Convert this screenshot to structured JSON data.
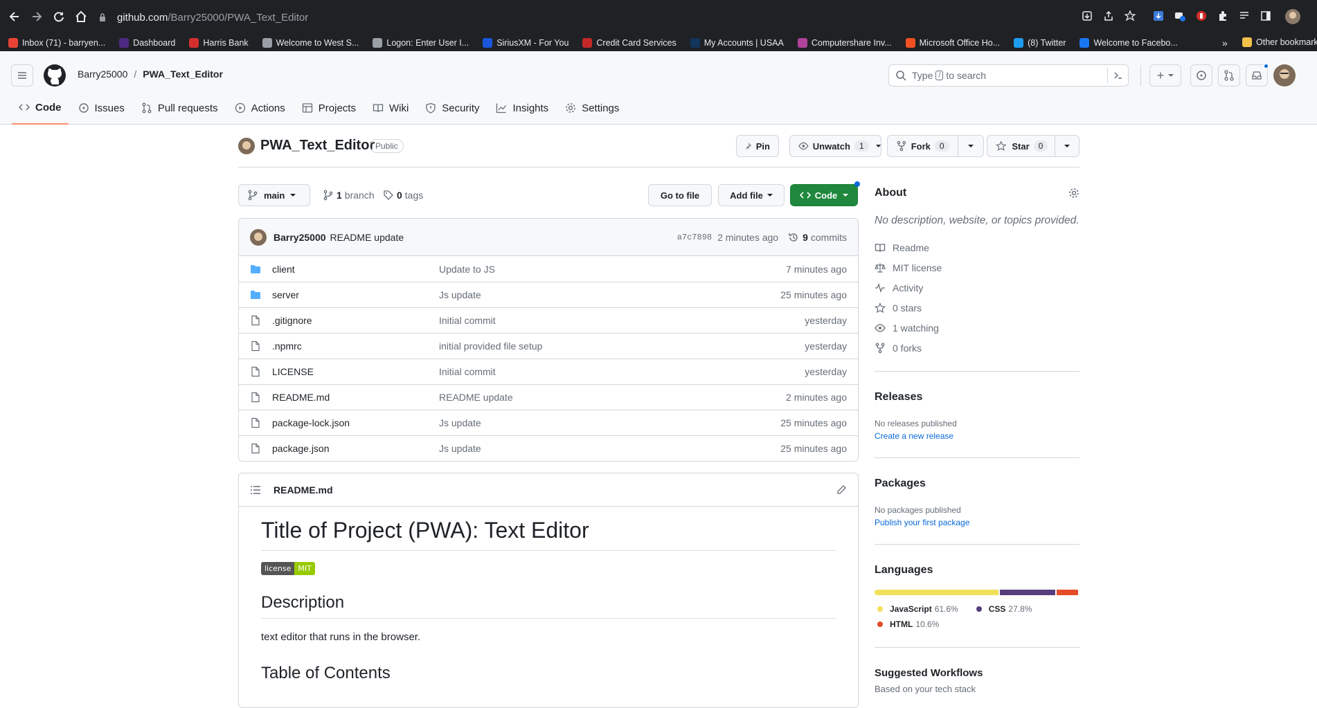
{
  "browser": {
    "url_host": "github.com",
    "url_path": "/Barry25000/PWA_Text_Editor",
    "bookmarks": [
      {
        "label": "Inbox (71) - barryen...",
        "color": "#ea4335"
      },
      {
        "label": "Dashboard",
        "color": "#4e2a84"
      },
      {
        "label": "Harris Bank",
        "color": "#d32f2f"
      },
      {
        "label": "Welcome to West S...",
        "color": "#9aa0a6"
      },
      {
        "label": "Logon: Enter User I...",
        "color": "#9aa0a6"
      },
      {
        "label": "SiriusXM - For You",
        "color": "#1a56db"
      },
      {
        "label": "Credit Card Services",
        "color": "#c62828"
      },
      {
        "label": "My Accounts | USAA",
        "color": "#12355b"
      },
      {
        "label": "Computershare Inv...",
        "color": "#b0439b"
      },
      {
        "label": "Microsoft Office Ho...",
        "color": "#f25022"
      },
      {
        "label": "(8) Twitter",
        "color": "#1d9bf0"
      },
      {
        "label": "Welcome to Facebo...",
        "color": "#1877f2"
      }
    ],
    "other_bookmarks": "Other bookmarks"
  },
  "header": {
    "owner": "Barry25000",
    "separator": "/",
    "repo": "PWA_Text_Editor",
    "search_prefix": "Type",
    "search_key": "/",
    "search_suffix": "to search",
    "plus_icon": "+"
  },
  "tabs": [
    {
      "label": "Code",
      "icon": "code-icon"
    },
    {
      "label": "Issues",
      "icon": "issue-icon"
    },
    {
      "label": "Pull requests",
      "icon": "pull-request-icon"
    },
    {
      "label": "Actions",
      "icon": "play-icon"
    },
    {
      "label": "Projects",
      "icon": "table-icon"
    },
    {
      "label": "Wiki",
      "icon": "book-icon"
    },
    {
      "label": "Security",
      "icon": "shield-icon"
    },
    {
      "label": "Insights",
      "icon": "graph-icon"
    },
    {
      "label": "Settings",
      "icon": "gear-icon"
    }
  ],
  "repo": {
    "name": "PWA_Text_Editor",
    "visibility": "Public",
    "pin": "Pin",
    "unwatch": "Unwatch",
    "watch_count": "1",
    "fork": "Fork",
    "fork_count": "0",
    "star": "Star",
    "star_count": "0"
  },
  "toolbar": {
    "branch": "main",
    "branches_count": "1",
    "branches_label": "branch",
    "tags_count": "0",
    "tags_label": "tags",
    "go_to_file": "Go to file",
    "add_file": "Add file",
    "code": "Code"
  },
  "commit": {
    "author": "Barry25000",
    "message": "README update",
    "sha": "a7c7898",
    "time": "2 minutes ago",
    "count": "9",
    "count_label": "commits"
  },
  "files": [
    {
      "name": "client",
      "type": "folder",
      "message": "Update to JS",
      "date": "7 minutes ago"
    },
    {
      "name": "server",
      "type": "folder",
      "message": "Js update",
      "date": "25 minutes ago"
    },
    {
      "name": ".gitignore",
      "type": "file",
      "message": "Initial commit",
      "date": "yesterday"
    },
    {
      "name": ".npmrc",
      "type": "file",
      "message": "initial provided file setup",
      "date": "yesterday"
    },
    {
      "name": "LICENSE",
      "type": "file",
      "message": "Initial commit",
      "date": "yesterday"
    },
    {
      "name": "README.md",
      "type": "file",
      "message": "README update",
      "date": "2 minutes ago"
    },
    {
      "name": "package-lock.json",
      "type": "file",
      "message": "Js update",
      "date": "25 minutes ago"
    },
    {
      "name": "package.json",
      "type": "file",
      "message": "Js update",
      "date": "25 minutes ago"
    }
  ],
  "readme": {
    "filename": "README.md",
    "title": "Title of Project (PWA): Text Editor",
    "badge_left": "license",
    "badge_right": "MIT",
    "h_description": "Description",
    "description": "text editor that runs in the browser.",
    "h_toc": "Table of Contents"
  },
  "about": {
    "heading": "About",
    "description": "No description, website, or topics provided.",
    "items": [
      {
        "label": "Readme",
        "icon": "book-icon"
      },
      {
        "label": "MIT license",
        "icon": "law-icon"
      },
      {
        "label": "Activity",
        "icon": "pulse-icon"
      },
      {
        "label": "0 stars",
        "icon": "star-icon"
      },
      {
        "label": "1 watching",
        "icon": "eye-icon"
      },
      {
        "label": "0 forks",
        "icon": "fork-icon"
      }
    ]
  },
  "releases": {
    "heading": "Releases",
    "none": "No releases published",
    "link": "Create a new release"
  },
  "packages": {
    "heading": "Packages",
    "none": "No packages published",
    "link": "Publish your first package"
  },
  "languages": {
    "heading": "Languages",
    "items": [
      {
        "name": "JavaScript",
        "percent": "61.6%",
        "value": 61.6,
        "color": "#f1e05a"
      },
      {
        "name": "CSS",
        "percent": "27.8%",
        "value": 27.8,
        "color": "#563d7c"
      },
      {
        "name": "HTML",
        "percent": "10.6%",
        "value": 10.6,
        "color": "#e34c26"
      }
    ]
  },
  "workflows": {
    "heading": "Suggested Workflows",
    "sub": "Based on your tech stack"
  }
}
